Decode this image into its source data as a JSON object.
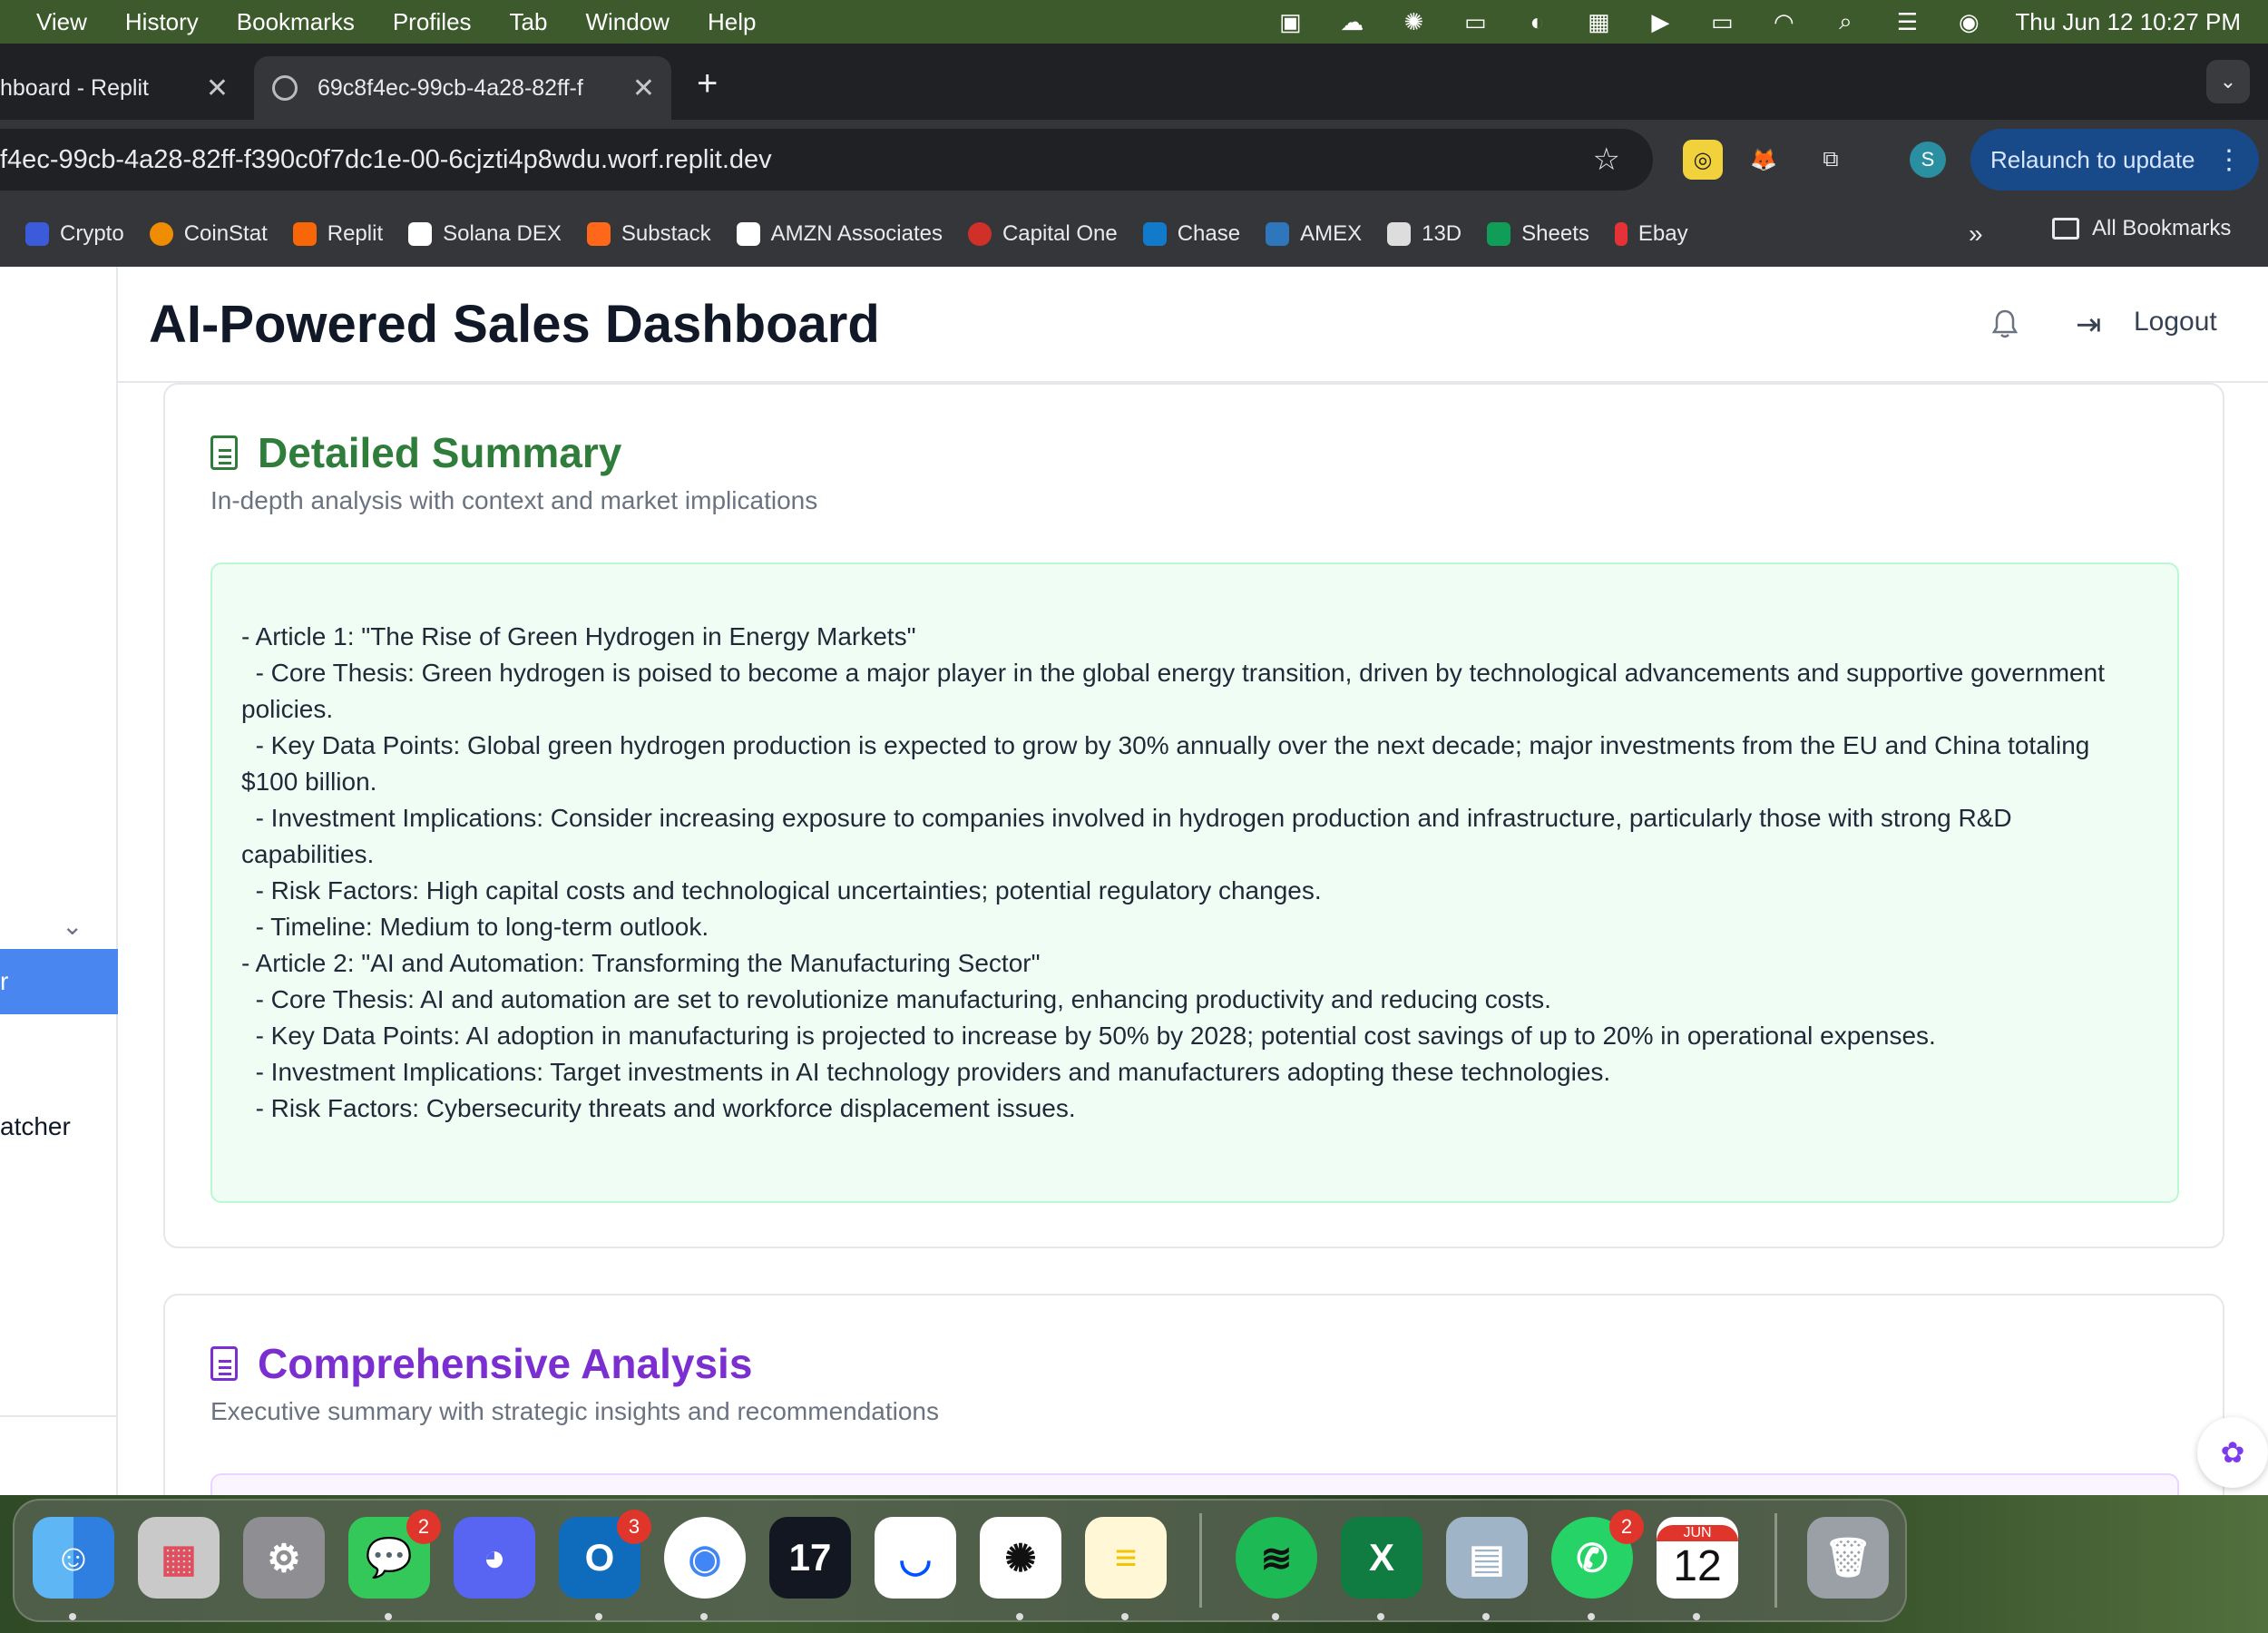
{
  "menubar": {
    "menus": [
      "View",
      "History",
      "Bookmarks",
      "Profiles",
      "Tab",
      "Window",
      "Help"
    ],
    "clock": "Thu Jun 12  10:27 PM"
  },
  "tabs": [
    {
      "title": "hboard - Replit"
    },
    {
      "title": "69c8f4ec-99cb-4a28-82ff-f"
    }
  ],
  "omnibox": {
    "url": "f4ec-99cb-4a28-82ff-f390c0f7dc1e-00-6cjzti4p8wdu.worf.replit.dev"
  },
  "profile": {
    "initial": "S"
  },
  "relaunch": {
    "label": "Relaunch to update"
  },
  "bookmarks": [
    {
      "label": "Crypto",
      "color": "#3b5bdb"
    },
    {
      "label": "CoinStat",
      "color": "#f08c00"
    },
    {
      "label": "Replit",
      "color": "#f76707"
    },
    {
      "label": "Solana DEX",
      "color": "#ffffff"
    },
    {
      "label": "Substack",
      "color": "#ff6719"
    },
    {
      "label": "AMZN Associates",
      "color": "#ffffff"
    },
    {
      "label": "Capital One",
      "color": "#d03027"
    },
    {
      "label": "Chase",
      "color": "#117aca"
    },
    {
      "label": "AMEX",
      "color": "#2e77bc"
    },
    {
      "label": "13D",
      "color": "#dddddd"
    },
    {
      "label": "Sheets",
      "color": "#0f9d58"
    },
    {
      "label": "Ebay",
      "color": "#e53238"
    }
  ],
  "bookmarks_all": "All Bookmarks",
  "sidebar": {
    "active_item": "r",
    "other_item": "atcher"
  },
  "header": {
    "title": "AI-Powered Sales Dashboard",
    "logout": "Logout"
  },
  "detailed": {
    "title": "Detailed Summary",
    "subtitle": "In-depth analysis with context and market implications",
    "lines": [
      "- Article 1: \"The Rise of Green Hydrogen in Energy Markets\"",
      "  - Core Thesis: Green hydrogen is poised to become a major player in the global energy transition, driven by technological advancements and supportive government policies.",
      "  - Key Data Points: Global green hydrogen production is expected to grow by 30% annually over the next decade; major investments from the EU and China totaling $100 billion.",
      "  - Investment Implications: Consider increasing exposure to companies involved in hydrogen production and infrastructure, particularly those with strong R&D capabilities.",
      "  - Risk Factors: High capital costs and technological uncertainties; potential regulatory changes.",
      "  - Timeline: Medium to long-term outlook.",
      "",
      "- Article 2: \"AI and Automation: Transforming the Manufacturing Sector\"",
      "  - Core Thesis: AI and automation are set to revolutionize manufacturing, enhancing productivity and reducing costs.",
      "  - Key Data Points: AI adoption in manufacturing is projected to increase by 50% by 2028; potential cost savings of up to 20% in operational expenses.",
      "  - Investment Implications: Target investments in AI technology providers and manufacturers adopting these technologies.",
      "  - Risk Factors: Cybersecurity threats and workforce displacement issues."
    ]
  },
  "comprehensive": {
    "title": "Comprehensive Analysis",
    "subtitle": "Executive summary with strategic insights and recommendations"
  },
  "dock": {
    "messages_badge": "2",
    "outlook_badge": "3",
    "whatsapp_badge": "2",
    "calendar_month": "JUN",
    "calendar_day": "12"
  }
}
